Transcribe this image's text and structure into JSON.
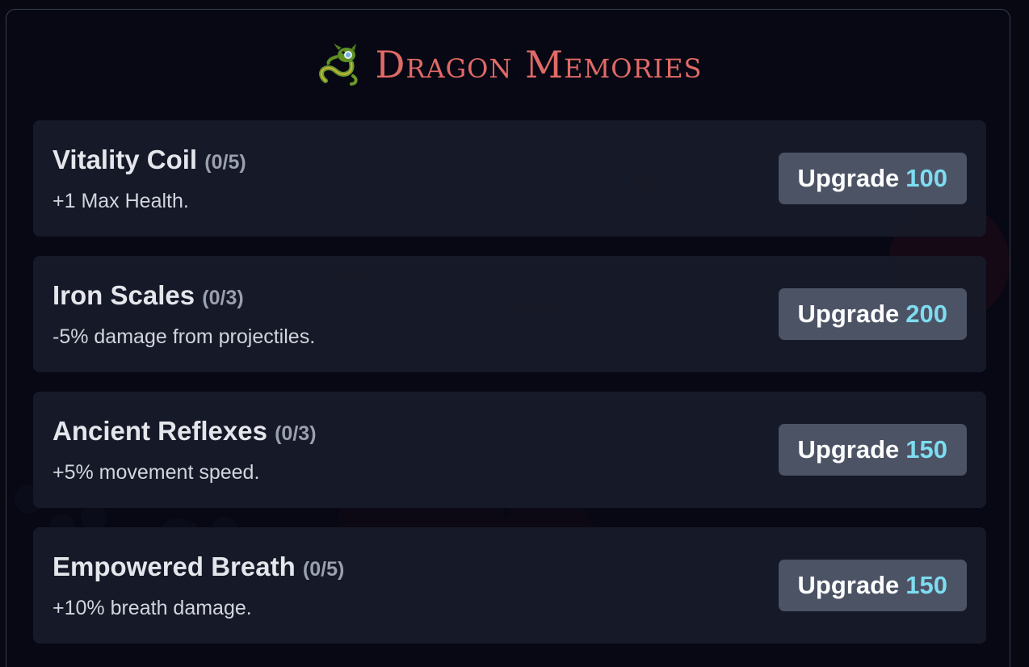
{
  "header": {
    "icon": "dragon-icon",
    "title": "Dragon Memories"
  },
  "colors": {
    "title": "#e06a66",
    "cost": "#7fdcef",
    "button_bg": "#4b5365",
    "card_bg": "#181b29"
  },
  "upgrades": [
    {
      "name": "Vitality Coil",
      "level": "(0/5)",
      "description": "+1 Max Health.",
      "button_label": "Upgrade",
      "cost": "100"
    },
    {
      "name": "Iron Scales",
      "level": "(0/3)",
      "description": "-5% damage from projectiles.",
      "button_label": "Upgrade",
      "cost": "200"
    },
    {
      "name": "Ancient Reflexes",
      "level": "(0/3)",
      "description": "+5% movement speed.",
      "button_label": "Upgrade",
      "cost": "150"
    },
    {
      "name": "Empowered Breath",
      "level": "(0/5)",
      "description": "+10% breath damage.",
      "button_label": "Upgrade",
      "cost": "150"
    }
  ]
}
